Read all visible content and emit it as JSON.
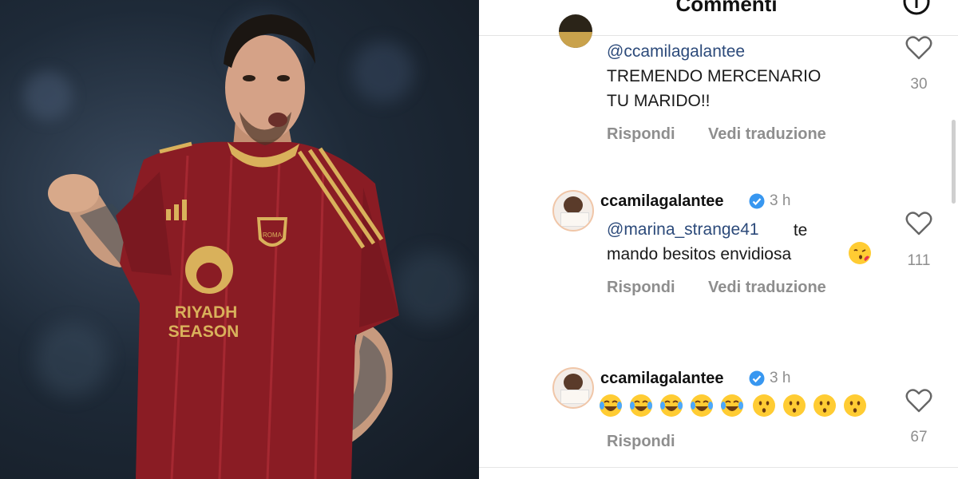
{
  "header": {
    "title": "Commenti",
    "info_icon": "info-icon"
  },
  "comments": [
    {
      "mention": "@ccamilagalantee",
      "text_line1": "TREMENDO MERCENARIO",
      "text_line2": "TU MARIDO!!",
      "reply_label": "Rispondi",
      "translate_label": "Vedi traduzione",
      "likes": "30"
    },
    {
      "username": "ccamilagalantee",
      "time": "3 h",
      "mention": "@marina_strange41",
      "text_after_mention": " te",
      "text_line2": "mando besitos envidiosa",
      "trailing_emoji": "face-blowing-kiss",
      "reply_label": "Rispondi",
      "translate_label": "Vedi traduzione",
      "likes": "111"
    },
    {
      "username": "ccamilagalantee",
      "time": "3 h",
      "emojis": [
        "face-with-tears-of-joy",
        "face-with-tears-of-joy",
        "face-with-tears-of-joy",
        "face-with-tears-of-joy",
        "face-with-tears-of-joy",
        "kissing-face",
        "kissing-face",
        "kissing-face",
        "kissing-face"
      ],
      "reply_label": "Rispondi",
      "likes": "67"
    }
  ],
  "photo": {
    "shirt_text_line1": "RIYADH",
    "shirt_text_line2": "SEASON",
    "badge_text": "ROMA"
  },
  "colors": {
    "accent_link": "#2c4a7a",
    "verified_blue": "#3897f0",
    "secondary_text": "#8e8e8e",
    "jersey": "#8a1c24",
    "jersey_gold": "#d9b15b"
  }
}
